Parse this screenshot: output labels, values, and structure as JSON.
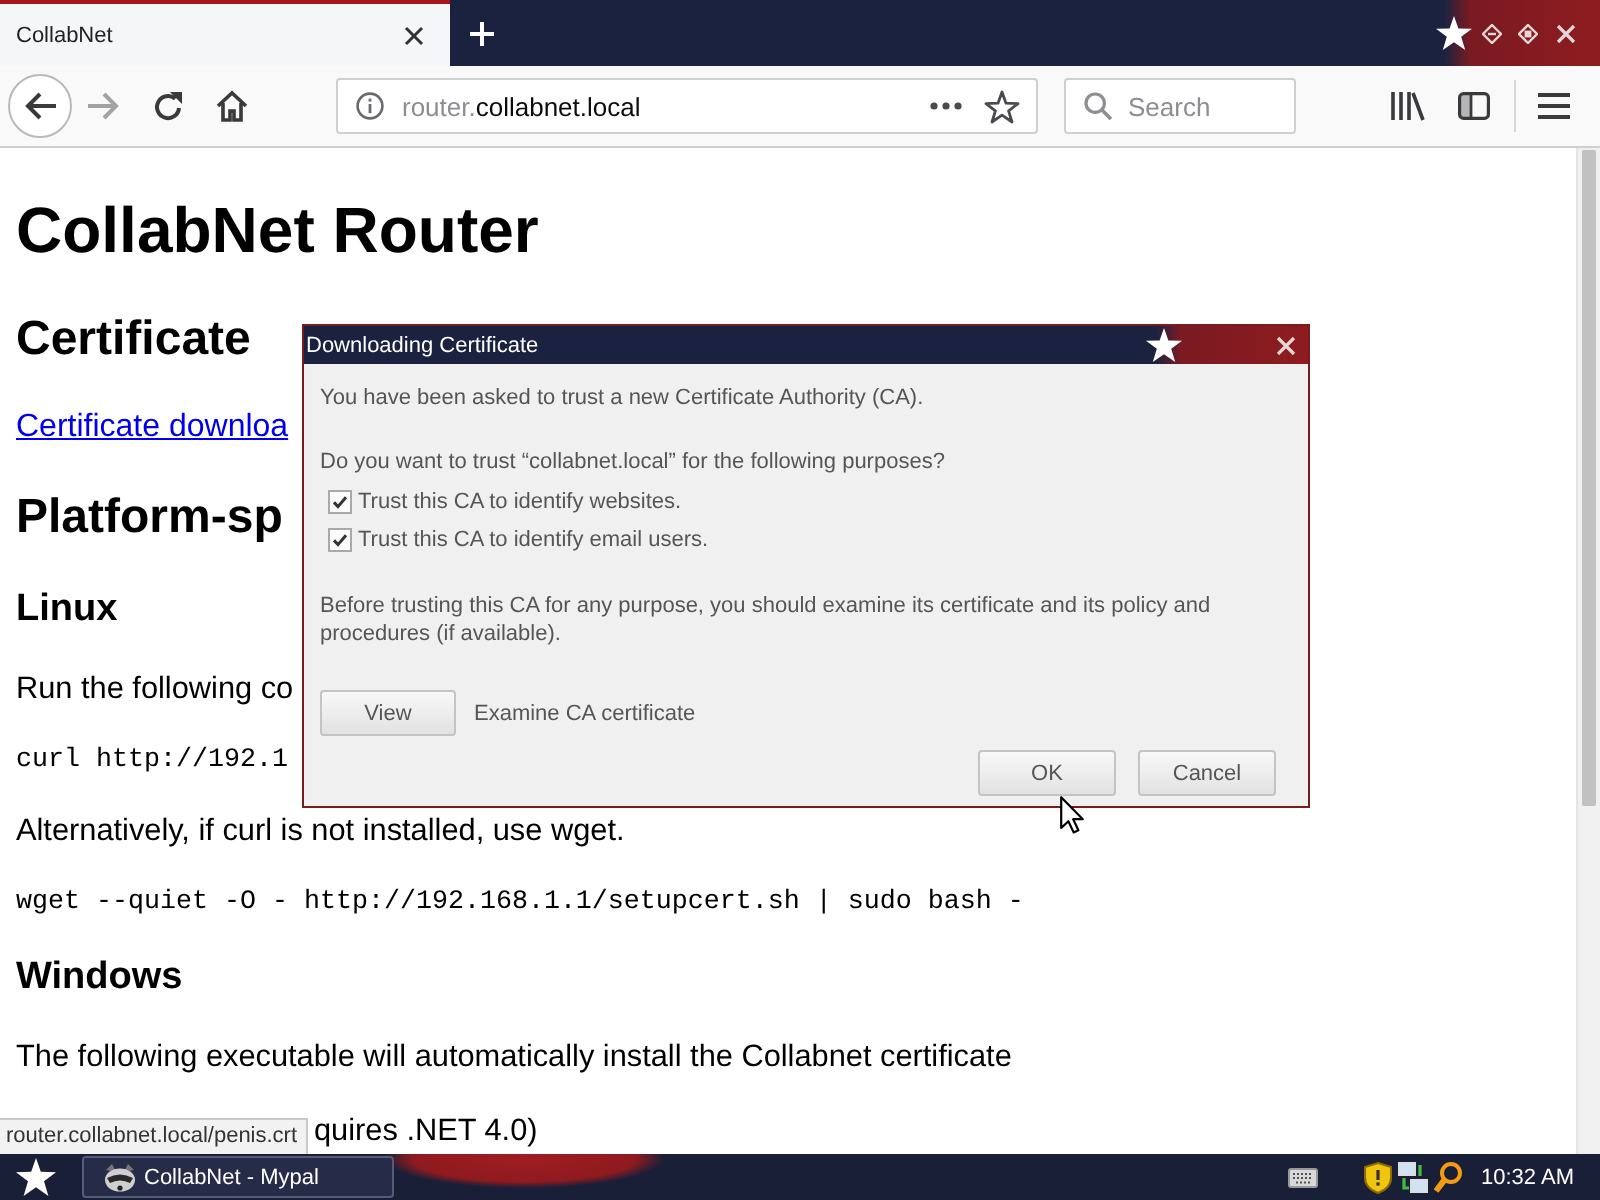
{
  "browser": {
    "tabs": [
      {
        "label": "CollabNet",
        "selected": true
      }
    ],
    "nav_buttons": [
      {
        "kind": "back",
        "disabled": false
      },
      {
        "kind": "forward",
        "disabled": true
      },
      {
        "kind": "reload",
        "disabled": false
      },
      {
        "kind": "home",
        "disabled": false
      }
    ],
    "address": {
      "prefix": "router.",
      "domain": "collabnet.local"
    },
    "search": {
      "placeholder": "Search"
    }
  },
  "page": {
    "blocks": [
      {
        "kind": "h1",
        "text": "CollabNet Router"
      },
      {
        "kind": "h2",
        "text": "Certificate"
      },
      {
        "kind": "link",
        "text": "Certificate downloa"
      },
      {
        "kind": "h2",
        "text": "Platform-sp"
      },
      {
        "kind": "h3",
        "text": "Linux"
      },
      {
        "kind": "p",
        "text": "Run the following co"
      },
      {
        "kind": "code",
        "text": "curl http://192.1"
      },
      {
        "kind": "p",
        "text": "Alternatively, if curl is not installed, use wget."
      },
      {
        "kind": "code",
        "text": "wget --quiet -O - http://192.168.1.1/setupcert.sh | sudo bash -"
      },
      {
        "kind": "h3",
        "text": "Windows"
      },
      {
        "kind": "p",
        "text": "The following executable will automatically install the Collabnet certificate"
      },
      {
        "kind": "clipped_p",
        "text": "quires .NET 4.0)"
      }
    ],
    "status_link": "router.collabnet.local/penis.crt"
  },
  "dialog": {
    "title": "Downloading Certificate",
    "intro": "You have been asked to trust a new Certificate Authority (CA).",
    "question": "Do you want to trust “collabnet.local” for the following purposes?",
    "options": [
      {
        "label": "Trust this CA to identify websites.",
        "checked": true
      },
      {
        "label": "Trust this CA to identify email users.",
        "checked": true
      }
    ],
    "advice": "Before trusting this CA for any purpose, you should examine its certificate and its policy and procedures (if available).",
    "view": {
      "button": "View",
      "caption": "Examine CA certificate"
    },
    "buttons": [
      "OK",
      "Cancel"
    ]
  },
  "taskbar": {
    "windows": [
      {
        "label": "CollabNet - Mypal"
      }
    ],
    "clock": "10:32 AM"
  }
}
